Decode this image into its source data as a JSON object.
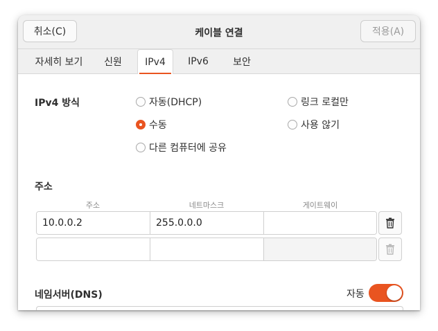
{
  "header": {
    "cancel_label": "취소(C)",
    "title": "케이블 연결",
    "apply_label": "적용(A)"
  },
  "tabs": [
    {
      "label": "자세히 보기",
      "active": false
    },
    {
      "label": "신원",
      "active": false
    },
    {
      "label": "IPv4",
      "active": true
    },
    {
      "label": "IPv6",
      "active": false
    },
    {
      "label": "보안",
      "active": false
    }
  ],
  "method": {
    "label": "IPv4 방식",
    "options": {
      "auto": "자동(DHCP)",
      "link_local": "링크 로컬만",
      "manual": "수동",
      "disabled": "사용 않기",
      "shared": "다른 컴퓨터에 공유"
    },
    "selected": "수동"
  },
  "addresses": {
    "label": "주소",
    "columns": [
      "주소",
      "네트마스크",
      "게이트웨이"
    ],
    "rows": [
      {
        "address": "10.0.0.2",
        "netmask": "255.0.0.0",
        "gateway": ""
      },
      {
        "address": "",
        "netmask": "",
        "gateway": ""
      }
    ]
  },
  "dns": {
    "label": "네임서버(DNS)",
    "auto_label": "자동",
    "auto_enabled": true,
    "value": ""
  },
  "colors": {
    "accent": "#e95420",
    "header_bg": "#f0f0f0"
  },
  "icons": [
    "trash-icon"
  ]
}
